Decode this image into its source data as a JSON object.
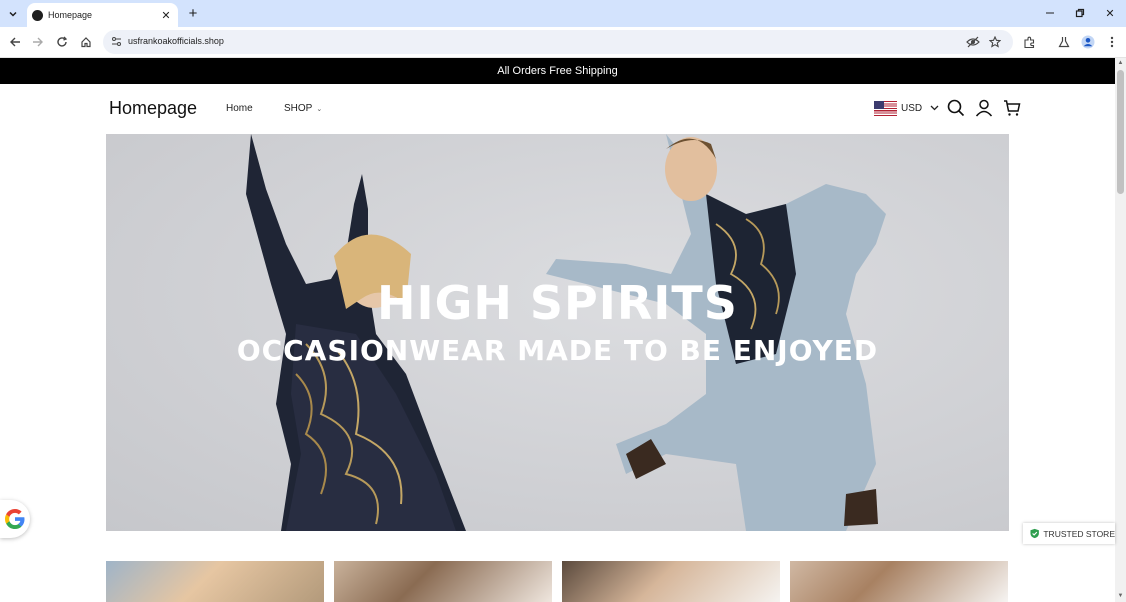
{
  "browser": {
    "tab_title": "Homepage",
    "url": "usfrankoakofficials.shop",
    "icons": {
      "tab_list": "chevron-down-icon",
      "close_tab": "close-icon",
      "new_tab": "plus-icon",
      "minimize": "minimize-icon",
      "restore": "restore-icon",
      "close_window": "close-icon",
      "back": "back-arrow-icon",
      "forward": "forward-arrow-icon",
      "reload": "reload-icon",
      "home": "home-icon",
      "site_info": "tune-icon",
      "eye_off": "eye-off-icon",
      "bookmark": "star-icon",
      "extensions": "puzzle-icon",
      "labs": "flask-icon",
      "profile": "avatar-icon",
      "menu": "kebab-menu-icon"
    }
  },
  "announcement": {
    "text": "All Orders Free Shipping"
  },
  "header": {
    "logo": "Homepage",
    "nav": {
      "home": "Home",
      "shop": "SHOP"
    },
    "currency": {
      "code": "USD"
    },
    "icons": {
      "search": "search-icon",
      "account": "user-icon",
      "cart": "cart-icon"
    }
  },
  "hero": {
    "title": "HIGH SPIRITS",
    "subtitle": "OCCASIONWEAR MADE TO BE ENJOYED"
  },
  "badges": {
    "trusted_store": "TRUSTED STORE"
  },
  "colors": {
    "tabstrip": "#d3e3fd",
    "announcement_bg": "#000000",
    "trusted_shield": "#2e9e4f"
  }
}
